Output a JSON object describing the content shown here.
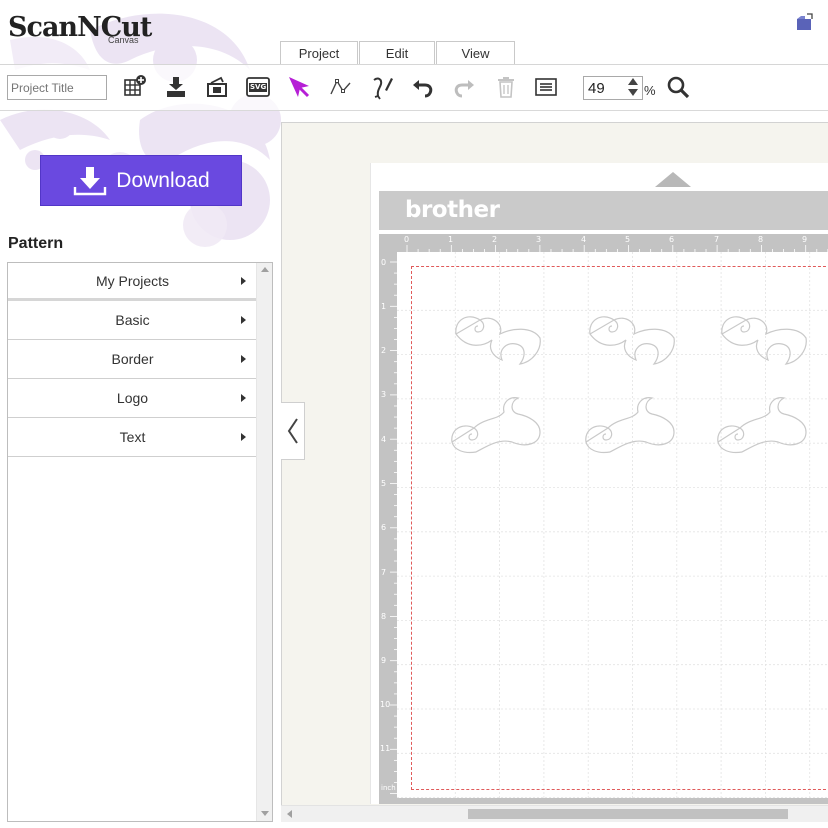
{
  "app": {
    "logo_text": "ScanNCut",
    "logo_sub": "Canvas"
  },
  "tabs": [
    {
      "label": "Project"
    },
    {
      "label": "Edit"
    },
    {
      "label": "View"
    }
  ],
  "toolbar": {
    "project_title_placeholder": "Project Title",
    "zoom_value": "49",
    "zoom_unit": "%",
    "icons": [
      "new-project-icon",
      "import-icon",
      "save-icon",
      "svg-icon",
      "select-arrow-icon",
      "node-edit-icon",
      "rotate-tool-icon",
      "undo-icon",
      "redo-icon",
      "delete-icon",
      "align-icon",
      "zoom-search-icon"
    ],
    "svg_badge": "SVG",
    "select_color": "#b61fd6"
  },
  "sidebar": {
    "download_label": "Download",
    "download_color": "#6a49e0",
    "pattern_heading": "Pattern",
    "items": [
      {
        "label": "My Projects"
      },
      {
        "label": "Basic"
      },
      {
        "label": "Border"
      },
      {
        "label": "Logo"
      },
      {
        "label": "Text"
      }
    ]
  },
  "mat": {
    "brand": "brother",
    "ruler_top_labels": [
      "0",
      "1",
      "2",
      "3",
      "4",
      "5",
      "6",
      "7",
      "8",
      "9"
    ],
    "ruler_left_labels": [
      "0",
      "1",
      "2",
      "3",
      "4",
      "5",
      "6",
      "7",
      "8",
      "9",
      "10",
      "11"
    ],
    "ruler_unit": "inch",
    "cut_border_color": "#e05a5a"
  }
}
